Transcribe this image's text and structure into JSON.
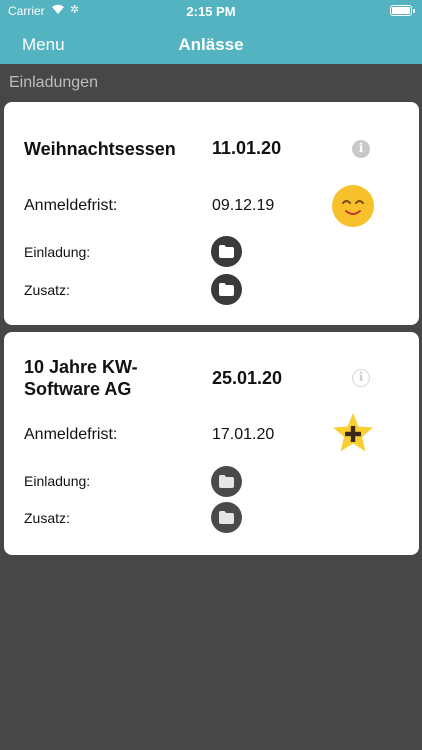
{
  "status_bar": {
    "carrier": "Carrier",
    "time": "2:15 PM"
  },
  "nav": {
    "menu_label": "Menu",
    "title": "Anlässe"
  },
  "section": {
    "label": "Einladungen"
  },
  "events": [
    {
      "title": "Weihnachtsessen",
      "date": "11.01.20",
      "deadline_label": "Anmeldefrist:",
      "deadline": "09.12.19",
      "invitation_label": "Einladung:",
      "extra_label": "Zusatz:",
      "status_icon": "smiley-face-icon"
    },
    {
      "title": "10 Jahre KW-\nSoftware AG",
      "date": "25.01.20",
      "deadline_label": "Anmeldefrist:",
      "deadline": "17.01.20",
      "invitation_label": "Einladung:",
      "extra_label": "Zusatz:",
      "status_icon": "star-plus-icon"
    }
  ],
  "colors": {
    "nav_background": "#53b3c0",
    "page_background": "#474747",
    "card_background": "#ffffff",
    "smiley_yellow": "#f6c12a",
    "star_yellow": "#f9ce31"
  }
}
